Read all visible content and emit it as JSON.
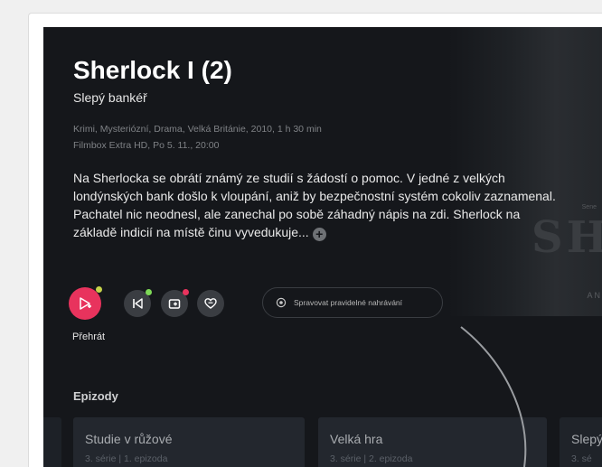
{
  "show": {
    "title": "Sherlock I (2)",
    "episode_title": "Slepý bankéř",
    "meta_line1": "Krimi, Mysteriózní, Drama, Velká Británie, 2010, 1 h 30 min",
    "meta_line2": "Filmbox Extra HD, Po 5. 11., 20:00",
    "description": "Na Sherlocka se obrátí známý ze studií s žádostí o pomoc. V jedné z velkých londýnských bank došlo k vloupání, aniž by bezpečnostní systém cokoliv zaznamenal. Pachatel nic neodnesl, ale zanechal po sobě záhadný nápis na zdi. Sherlock na základě indicií na místě činu vyvedukuje...",
    "more_symbol": "+"
  },
  "hero": {
    "poster_big_text": "SH",
    "poster_small_text": "A N",
    "poster_tiny_text": "Sene"
  },
  "actions": {
    "play_label": "Přehrát",
    "record_label": "Spravovat pravidelné nahrávání",
    "icons": {
      "play": "play-plus-icon",
      "restart": "skip-back-icon",
      "record": "record-icon",
      "favorite": "heart-icon",
      "record_series": "record-series-icon"
    },
    "badge_colors": {
      "play": "#c6d34a",
      "restart": "#7ed957",
      "record": "#e8335d"
    }
  },
  "episodes": {
    "section_title": "Epizody",
    "items": [
      {
        "title": "",
        "subtitle": ""
      },
      {
        "title": "Studie v růžové",
        "subtitle": "3. série | 1. epizoda"
      },
      {
        "title": "Velká hra",
        "subtitle": "3. série | 2. epizoda"
      },
      {
        "title": "Slepý",
        "subtitle": "3. sé"
      }
    ]
  },
  "colors": {
    "background": "#15171b",
    "accent": "#e8335d",
    "card": "#23272e"
  }
}
